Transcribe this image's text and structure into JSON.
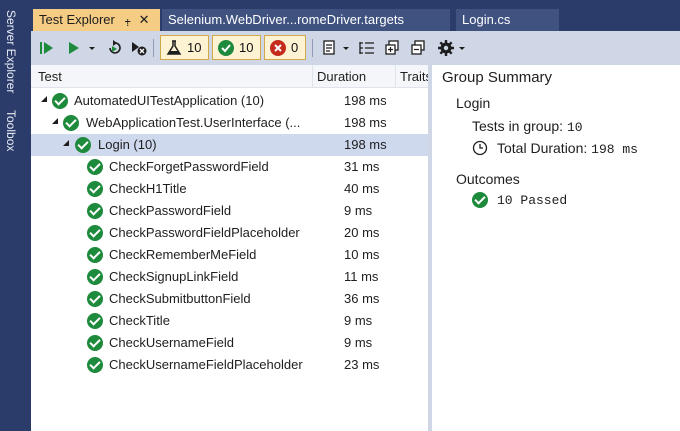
{
  "sidebar": {
    "server_explorer": "Server Explorer",
    "toolbox": "Toolbox"
  },
  "tabs": {
    "active": "Test Explorer",
    "pin_glyph": "⨥",
    "close_glyph": "✕",
    "tab2": "Selenium.WebDriver...romeDriver.targets",
    "tab3": "Login.cs"
  },
  "toolbar": {
    "total_count": "10",
    "passed_count": "10",
    "failed_count": "0"
  },
  "columns": {
    "test": "Test",
    "duration": "Duration",
    "traits": "Traits"
  },
  "tree": {
    "root": {
      "name": "AutomatedUITestApplication (10)",
      "duration": "198 ms"
    },
    "namespace": {
      "name": "WebApplicationTest.UserInterface (...",
      "duration": "198 ms"
    },
    "group": {
      "name": "Login (10)",
      "duration": "198 ms"
    },
    "tests": [
      {
        "name": "CheckForgetPasswordField",
        "duration": "31 ms"
      },
      {
        "name": "CheckH1Title",
        "duration": "40 ms"
      },
      {
        "name": "CheckPasswordField",
        "duration": "9 ms"
      },
      {
        "name": "CheckPasswordFieldPlaceholder",
        "duration": "20 ms"
      },
      {
        "name": "CheckRememberMeField",
        "duration": "10 ms"
      },
      {
        "name": "CheckSignupLinkField",
        "duration": "11 ms"
      },
      {
        "name": "CheckSubmitbuttonField",
        "duration": "36 ms"
      },
      {
        "name": "CheckTitle",
        "duration": "9 ms"
      },
      {
        "name": "CheckUsernameField",
        "duration": "9 ms"
      },
      {
        "name": "CheckUsernameFieldPlaceholder",
        "duration": "23 ms"
      }
    ]
  },
  "summary": {
    "title": "Group Summary",
    "group_name": "Login",
    "tests_in_group_label": "Tests in group:",
    "tests_in_group_value": "10",
    "total_duration_label": "Total Duration:",
    "total_duration_value": "198 ms",
    "outcomes_label": "Outcomes",
    "passed_text": "10 Passed"
  },
  "colors": {
    "accent_tab": "#f5cc84",
    "passed": "#1e8a3c",
    "failed": "#c42b1c",
    "selection": "#cfd9ee"
  }
}
